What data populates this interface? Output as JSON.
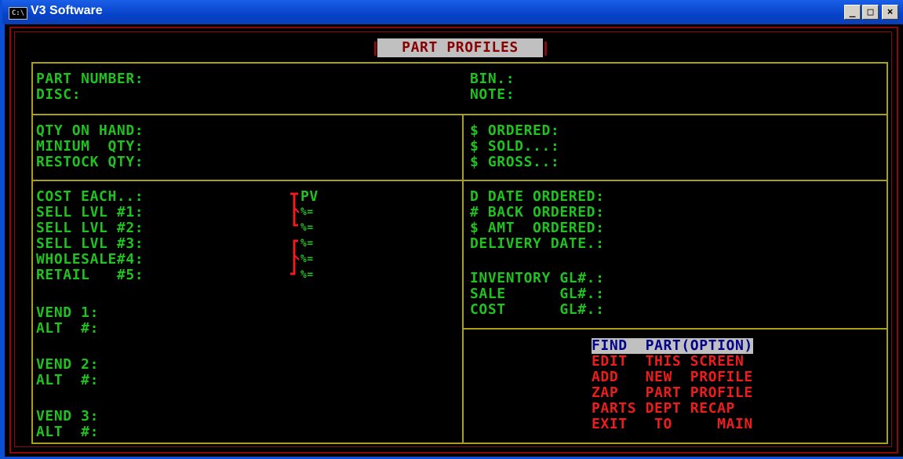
{
  "window": {
    "title": "V3 Software",
    "icon": "C:\\",
    "controls": [
      "_",
      "□",
      "×"
    ]
  },
  "screen": {
    "title": "PART PROFILES"
  },
  "top": {
    "left": [
      "PART NUMBER:",
      "DISC:"
    ],
    "right": [
      "BIN.:",
      "NOTE:"
    ]
  },
  "qty": {
    "left": [
      "QTY ON HAND:",
      "MINIUM  QTY:",
      "RESTOCK QTY:"
    ],
    "right": [
      "$ ORDERED:",
      "$ SOLD...:",
      "$ GROSS..:"
    ]
  },
  "pricing": {
    "labels": [
      "COST EACH..:",
      "SELL LVL #1:",
      "SELL LVL #2:",
      "SELL LVL #3:",
      "WHOLESALE#4:",
      "RETAIL   #5:"
    ],
    "pv_label": "PV",
    "pct_labels": [
      "%=",
      "%=",
      "%=",
      "%=",
      "%="
    ]
  },
  "order": {
    "lines": [
      "D DATE ORDERED:",
      "# BACK ORDERED:",
      "$ AMT  ORDERED:",
      "DELIVERY DATE.:"
    ]
  },
  "gl": {
    "lines": [
      "INVENTORY GL#.:",
      "SALE      GL#.:",
      "COST      GL#.:"
    ]
  },
  "vendors": [
    {
      "vend": "VEND 1:",
      "alt": "ALT  #:"
    },
    {
      "vend": "VEND 2:",
      "alt": "ALT  #:"
    },
    {
      "vend": "VEND 3:",
      "alt": "ALT  #:"
    }
  ],
  "menu": {
    "items": [
      "FIND  PART(OPTION)",
      "EDIT  THIS SCREEN",
      "ADD   NEW  PROFILE",
      "ZAP   PART PROFILE",
      "PARTS DEPT RECAP",
      "EXIT   TO     MAIN"
    ]
  }
}
